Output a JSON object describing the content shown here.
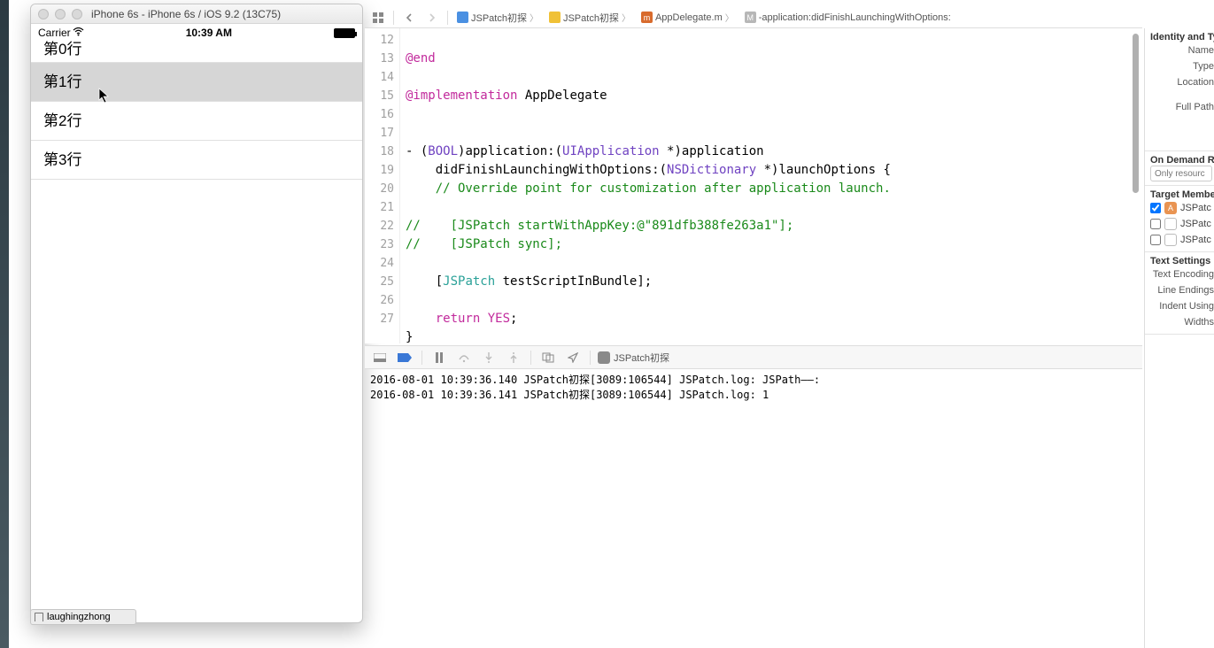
{
  "simulator": {
    "window_title": "iPhone 6s - iPhone 6s / iOS 9.2 (13C75)",
    "carrier": "Carrier",
    "time": "10:39 AM",
    "rows": [
      "第0行",
      "第1行",
      "第2行",
      "第3行"
    ]
  },
  "bottom_user": "laughingzhong",
  "jumpbar": {
    "project": "JSPatch初探",
    "folder": "JSPatch初探",
    "file": "AppDelegate.m",
    "symbol": "-application:didFinishLaunchingWithOptions:"
  },
  "code": {
    "line_start": 12,
    "line_end": 27,
    "l13": "@end",
    "l15a": "@implementation",
    "l15b": " AppDelegate",
    "l18a": "- (",
    "l18b": "BOOL",
    "l18c": ")application:(",
    "l18d": "UIApplication",
    "l18e": " *)application",
    "l18f": "    didFinishLaunchingWithOptions:(",
    "l18g": "NSDictionary",
    "l18h": " *)launchOptions {",
    "l19": "    // Override point for customization after application launch.",
    "l21": "//    [JSPatch startWithAppKey:@\"891dfb388fe263a1\"];",
    "l22": "//    [JSPatch sync];",
    "l24a": "    [",
    "l24b": "JSPatch",
    "l24c": " testScriptInBundle];",
    "l26a": "    ",
    "l26b": "return",
    "l26c": " ",
    "l26d": "YES",
    "l26e": ";",
    "l27": "}"
  },
  "debug": {
    "target": "JSPatch初探",
    "console_lines": [
      "2016-08-01 10:39:36.140 JSPatch初探[3089:106544] JSPatch.log: JSPath——:",
      "2016-08-01 10:39:36.141 JSPatch初探[3089:106544] JSPatch.log: 1"
    ]
  },
  "inspector": {
    "identity_hdr": "Identity and Ty",
    "name": "Name",
    "type": "Type",
    "location": "Location",
    "fullpath": "Full Path",
    "ondemand_hdr": "On Demand Re",
    "ondemand_placeholder": "Only resourc",
    "target_hdr": "Target Membe",
    "target1": "JSPatc",
    "target2": "JSPatc",
    "target3": "JSPatc",
    "text_hdr": "Text Settings",
    "text_enc": "Text Encoding",
    "line_end": "Line Endings",
    "indent": "Indent Using",
    "widths": "Widths"
  }
}
